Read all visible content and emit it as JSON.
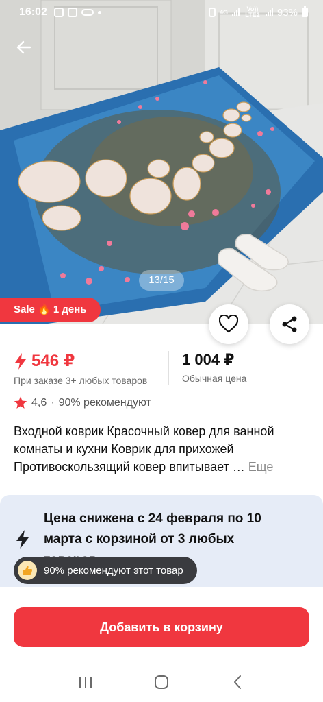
{
  "status_bar": {
    "time": "16:02",
    "network": "4G",
    "lte": "Vo)) LTE2",
    "battery": "93%"
  },
  "gallery": {
    "counter": "13/15"
  },
  "sale_badge": "Sale 🔥 1 день",
  "price": {
    "sale_price": "546 ₽",
    "sale_note": "При заказе 3+ любых товаров",
    "regular_price": "1 004 ₽",
    "regular_note": "Обычная цена"
  },
  "rating": {
    "score": "4,6",
    "separator": "·",
    "recommend": "90% рекомендуют"
  },
  "product": {
    "title": "Входной коврик Красочный ковер для ванной комнаты и кухни Коврик для прихожей Противоскользящий ковер впитывает …",
    "more_label": "Еще"
  },
  "promo": {
    "text": "Цена снижена с 24 февраля по 10 марта с корзиной от 3 любых товаров"
  },
  "recommend_pill": "90% рекомендуют этот товар",
  "add_to_cart": "Добавить в корзину",
  "colors": {
    "accent": "#f0373f",
    "promo_bg": "#e6ecf7",
    "pill_bg": "#3a3b3f"
  },
  "icons": [
    "back-arrow-icon",
    "heart-icon",
    "share-icon",
    "star-icon",
    "lightning-icon",
    "thumbs-up-icon",
    "nav-recent-icon",
    "nav-home-icon",
    "nav-back-icon"
  ]
}
